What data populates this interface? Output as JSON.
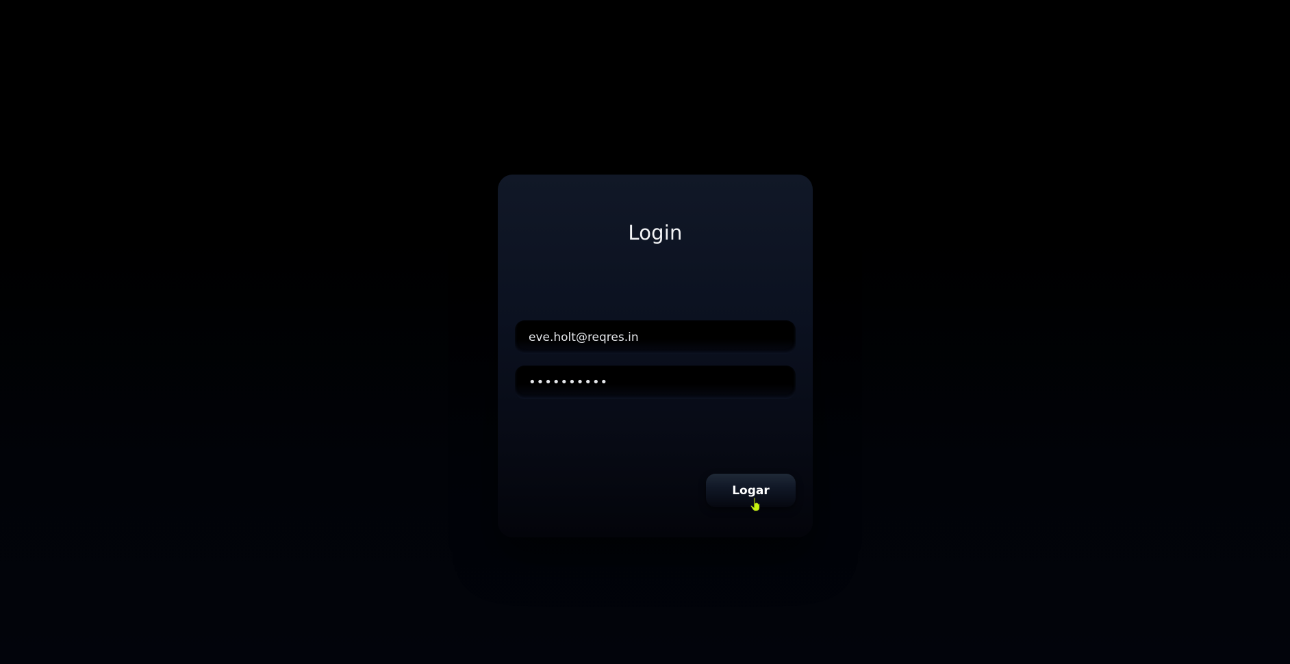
{
  "login": {
    "title": "Login",
    "email_value": "eve.holt@reqres.in",
    "password_value": "••••••••••",
    "submit_label": "Logar"
  },
  "colors": {
    "background": "#000000",
    "card": "#0b1120",
    "cursor_accent": "#c6f20f"
  },
  "icons": {
    "cursor": "hand-pointer-icon"
  }
}
